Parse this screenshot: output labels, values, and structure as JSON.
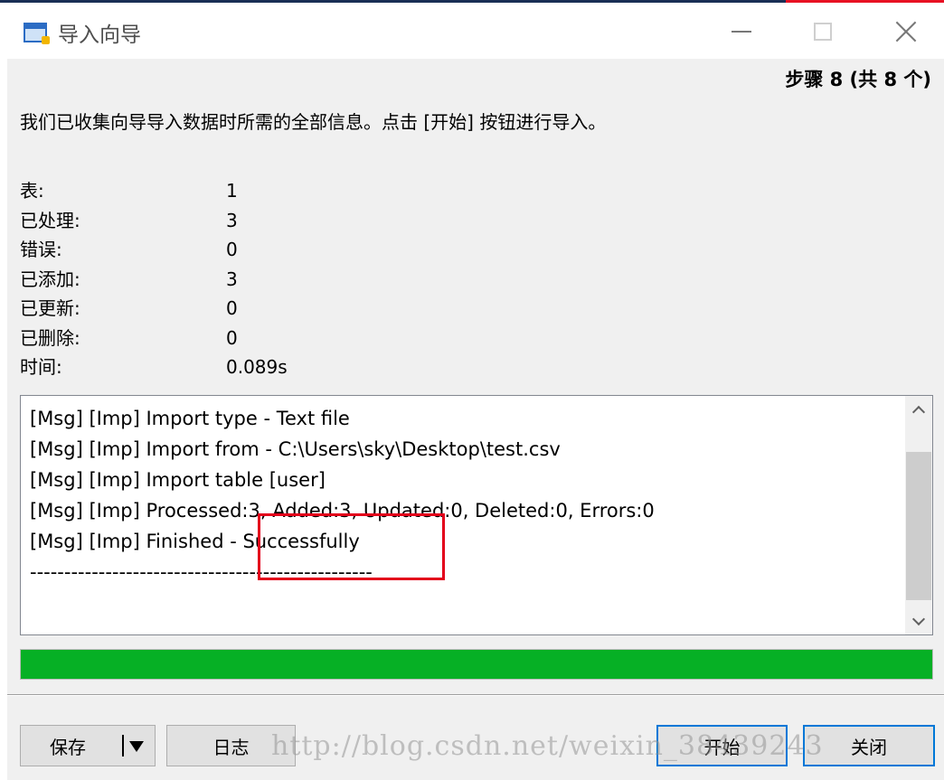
{
  "window": {
    "title": "导入向导",
    "icon": "import-wizard-icon",
    "controls": [
      "minimize-icon",
      "maximize-icon",
      "close-icon"
    ],
    "accent_color": "#1a2f55",
    "close_hover_color": "#e81123"
  },
  "header": {
    "step_label": "步骤 8 (共 8 个)",
    "instruction": "我们已收集向导导入数据时所需的全部信息。点击 [开始] 按钮进行导入。"
  },
  "stats": [
    {
      "label": "表:",
      "value": "1"
    },
    {
      "label": "已处理:",
      "value": "3"
    },
    {
      "label": "错误:",
      "value": "0"
    },
    {
      "label": "已添加:",
      "value": "3"
    },
    {
      "label": "已更新:",
      "value": "0"
    },
    {
      "label": "已删除:",
      "value": "0"
    },
    {
      "label": "时间:",
      "value": "0.089s"
    }
  ],
  "log": {
    "lines": [
      "[Msg] [Imp] Import type - Text file",
      "[Msg] [Imp] Import from - C:\\Users\\sky\\Desktop\\test.csv",
      "[Msg] [Imp] Import table [user]",
      "[Msg] [Imp] Processed:3, Added:3, Updated:0, Deleted:0, Errors:0",
      "[Msg] [Imp] Finished - Successfully",
      "--------------------------------------------------"
    ],
    "highlight_color": "#e3001b"
  },
  "progress": {
    "percent": 100,
    "color": "#06b025"
  },
  "buttons": {
    "save": "保存",
    "log": "日志",
    "start": "开始",
    "close": "关闭"
  },
  "watermark": "http://blog.csdn.net/weixin_38439243"
}
